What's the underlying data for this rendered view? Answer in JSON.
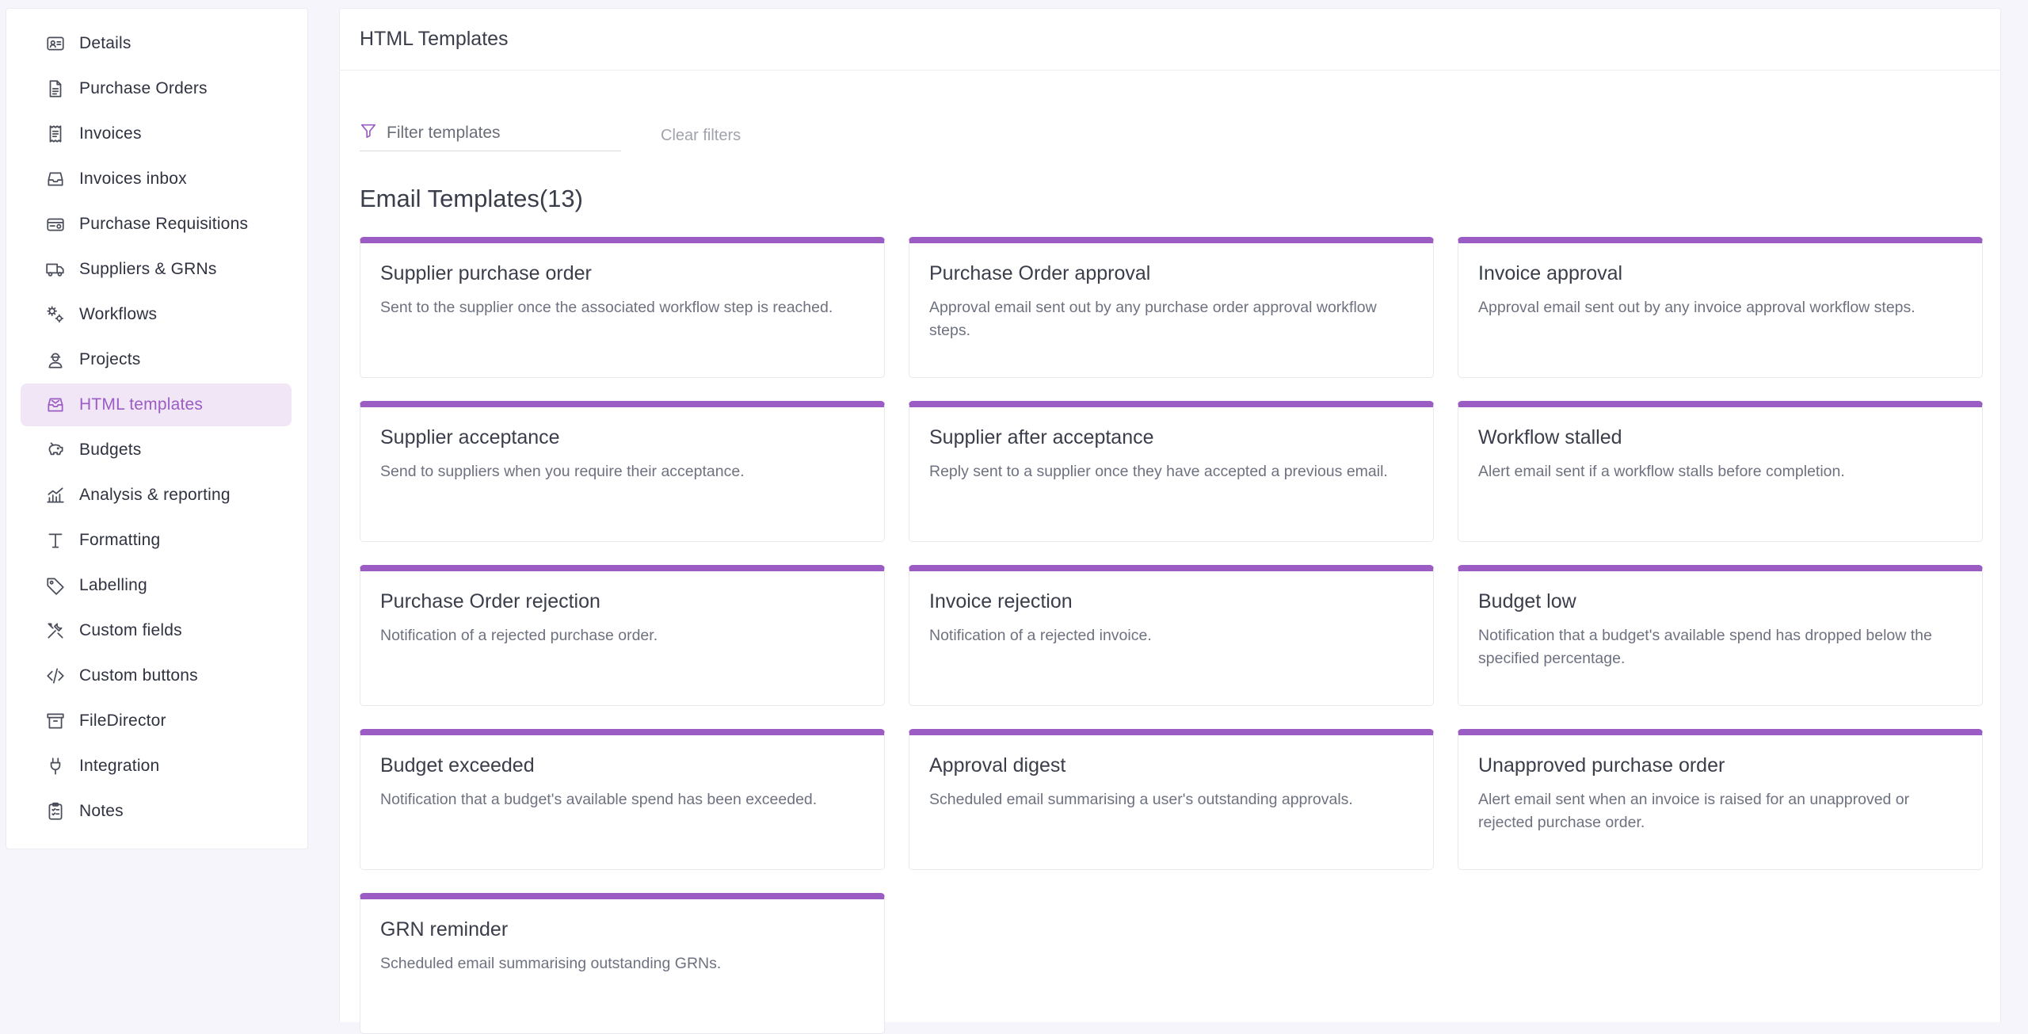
{
  "sidebar": {
    "items": [
      {
        "label": "Details",
        "icon": "id-card-icon"
      },
      {
        "label": "Purchase Orders",
        "icon": "document-icon"
      },
      {
        "label": "Invoices",
        "icon": "receipt-icon"
      },
      {
        "label": "Invoices inbox",
        "icon": "inbox-icon"
      },
      {
        "label": "Purchase Requisitions",
        "icon": "requisition-icon"
      },
      {
        "label": "Suppliers & GRNs",
        "icon": "truck-icon"
      },
      {
        "label": "Workflows",
        "icon": "gears-icon"
      },
      {
        "label": "Projects",
        "icon": "worker-icon"
      },
      {
        "label": "HTML templates",
        "icon": "mail-tray-icon",
        "active": true
      },
      {
        "label": "Budgets",
        "icon": "piggy-bank-icon"
      },
      {
        "label": "Analysis & reporting",
        "icon": "chart-icon"
      },
      {
        "label": "Formatting",
        "icon": "text-icon"
      },
      {
        "label": "Labelling",
        "icon": "tag-icon"
      },
      {
        "label": "Custom fields",
        "icon": "tools-icon"
      },
      {
        "label": "Custom buttons",
        "icon": "code-icon"
      },
      {
        "label": "FileDirector",
        "icon": "archive-icon"
      },
      {
        "label": "Integration",
        "icon": "plug-icon"
      },
      {
        "label": "Notes",
        "icon": "clipboard-icon"
      }
    ]
  },
  "header": {
    "title": "HTML Templates"
  },
  "filter": {
    "placeholder": "Filter templates",
    "clear_label": "Clear filters"
  },
  "section": {
    "title": "Email Templates(13)"
  },
  "templates": [
    {
      "title": "Supplier purchase order",
      "desc": "Sent to the supplier once the associated workflow step is reached."
    },
    {
      "title": "Purchase Order approval",
      "desc": "Approval email sent out by any purchase order approval workflow steps."
    },
    {
      "title": "Invoice approval",
      "desc": "Approval email sent out by any invoice approval workflow steps."
    },
    {
      "title": "Supplier acceptance",
      "desc": "Send to suppliers when you require their acceptance."
    },
    {
      "title": "Supplier after acceptance",
      "desc": "Reply sent to a supplier once they have accepted a previous email."
    },
    {
      "title": "Workflow stalled",
      "desc": "Alert email sent if a workflow stalls before completion."
    },
    {
      "title": "Purchase Order rejection",
      "desc": "Notification of a rejected purchase order."
    },
    {
      "title": "Invoice rejection",
      "desc": "Notification of a rejected invoice."
    },
    {
      "title": "Budget low",
      "desc": "Notification that a budget's available spend has dropped below the specified percentage."
    },
    {
      "title": "Budget exceeded",
      "desc": "Notification that a budget's available spend has been exceeded."
    },
    {
      "title": "Approval digest",
      "desc": "Scheduled email summarising a user's outstanding approvals."
    },
    {
      "title": "Unapproved purchase order",
      "desc": "Alert email sent when an invoice is raised for an unapproved or rejected purchase order."
    },
    {
      "title": "GRN reminder",
      "desc": "Scheduled email summarising outstanding GRNs."
    }
  ],
  "colors": {
    "accent": "#9b5cc4",
    "active_bg": "#f1e6f6"
  }
}
